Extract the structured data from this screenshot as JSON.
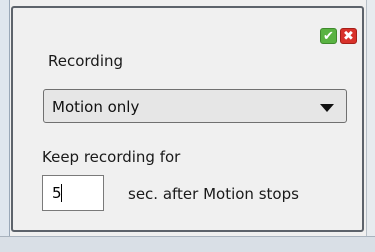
{
  "dialog": {
    "title": "Recording",
    "ok_icon": "check-icon",
    "ok_glyph": "✔",
    "cancel_icon": "close-icon",
    "cancel_glyph": "✖",
    "accent_ok": "#59b342",
    "accent_cancel": "#d8312a"
  },
  "recording_mode": {
    "selected": "Motion only"
  },
  "keep_recording": {
    "label": "Keep recording for",
    "value": "5",
    "suffix": "sec. after Motion stops"
  }
}
